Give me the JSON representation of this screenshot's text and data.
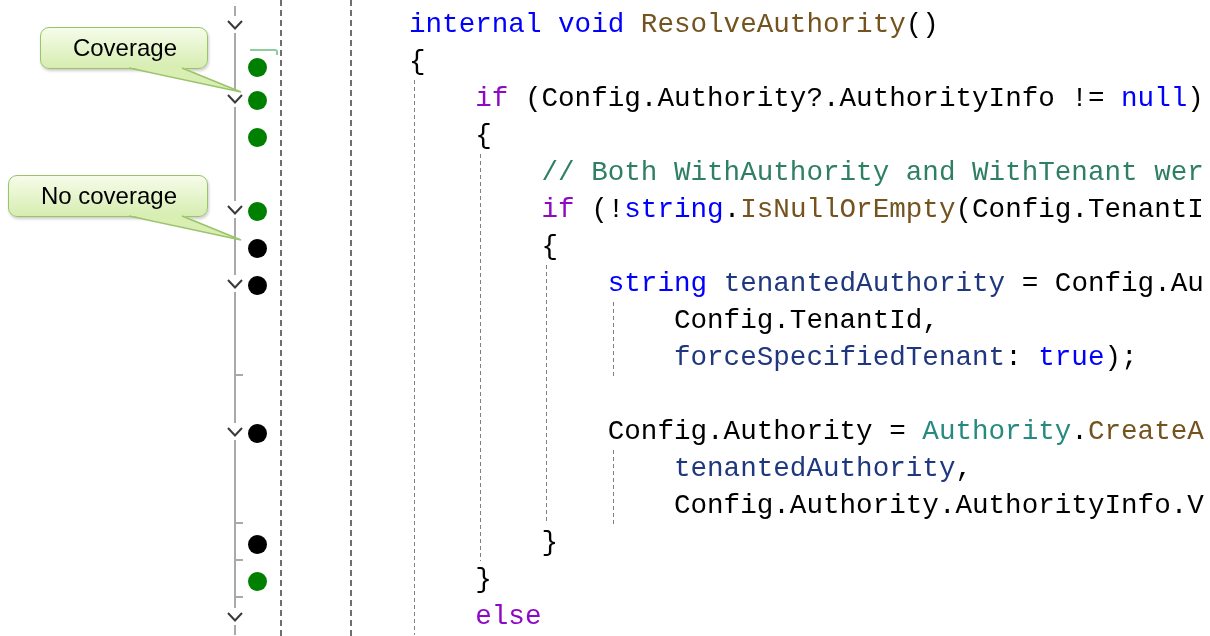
{
  "editor": {
    "lines": [
      {
        "kind": "start",
        "bracket": false,
        "tokens": [
          {
            "kind": "keyword",
            "text": "internal void "
          },
          {
            "kind": "method",
            "text": "ResolveAuthority"
          },
          {
            "kind": "plain",
            "text": "()"
          }
        ]
      },
      {
        "kind": "body",
        "bracket": true,
        "coverage": {
          "color": "#008000"
        },
        "tokens": [
          {
            "kind": "plain",
            "text": "{"
          }
        ],
        "children": [
          {
            "kind": "start",
            "bracket": false,
            "coverage": {
              "color": "#008000"
            },
            "callout": {
              "text": "Coverage"
            },
            "tokens": [
              {
                "kind": "control",
                "text": "if"
              },
              {
                "kind": "plain",
                "text": " (Config.Authority?.AuthorityInfo != "
              },
              {
                "kind": "keyword",
                "text": "null"
              },
              {
                "kind": "plain",
                "text": ")"
              }
            ]
          },
          {
            "kind": "body",
            "bracket": false,
            "coverage": {
              "color": "#008000"
            },
            "tokens": [
              {
                "kind": "plain",
                "text": "{"
              }
            ],
            "children": [
              {
                "kind": "body",
                "bracket": false,
                "tokens": [
                  {
                    "kind": "comment",
                    "text": "// Both WithAuthority and WithTenant wer"
                  }
                ]
              },
              {
                "kind": "start",
                "bracket": false,
                "coverage": {
                  "color": "#008000"
                },
                "tokens": [
                  {
                    "kind": "control",
                    "text": "if"
                  },
                  {
                    "kind": "plain",
                    "text": " (!"
                  },
                  {
                    "kind": "keyword",
                    "text": "string"
                  },
                  {
                    "kind": "plain",
                    "text": "."
                  },
                  {
                    "kind": "method",
                    "text": "IsNullOrEmpty"
                  },
                  {
                    "kind": "plain",
                    "text": "(Config.TenantI"
                  }
                ]
              },
              {
                "kind": "body",
                "bracket": false,
                "coverage": {
                  "color": "#000000"
                },
                "callout": {
                  "text": "No coverage"
                },
                "tokens": [
                  {
                    "kind": "plain",
                    "text": "{"
                  }
                ],
                "children": [
                  {
                    "kind": "start",
                    "bracket": false,
                    "coverage": {
                      "color": "#000000"
                    },
                    "tokens": [
                      {
                        "kind": "keyword",
                        "text": "string "
                      },
                      {
                        "kind": "variable",
                        "text": "tenantedAuthority"
                      },
                      {
                        "kind": "plain",
                        "text": " = Config.Au"
                      }
                    ],
                    "children": [
                      {
                        "kind": "body",
                        "bracket": false,
                        "tokens": [
                          {
                            "kind": "plain",
                            "text": "Config.TenantId,"
                          }
                        ]
                      },
                      {
                        "kind": "end",
                        "bracket": false,
                        "tokens": [
                          {
                            "kind": "variable",
                            "text": "forceSpecifiedTenant"
                          },
                          {
                            "kind": "plain",
                            "text": ": "
                          },
                          {
                            "kind": "keyword",
                            "text": "true"
                          },
                          {
                            "kind": "plain",
                            "text": ");"
                          }
                        ]
                      }
                    ]
                  },
                  {
                    "kind": "body",
                    "bracket": false
                  },
                  {
                    "kind": "start",
                    "bracket": false,
                    "coverage": {
                      "color": "#000000"
                    },
                    "tokens": [
                      {
                        "kind": "plain",
                        "text": "Config.Authority = "
                      },
                      {
                        "kind": "type",
                        "text": "Authority"
                      },
                      {
                        "kind": "plain",
                        "text": "."
                      },
                      {
                        "kind": "method",
                        "text": "CreateA"
                      }
                    ],
                    "children": [
                      {
                        "kind": "body",
                        "bracket": false,
                        "tokens": [
                          {
                            "kind": "variable",
                            "text": "tenantedAuthority"
                          },
                          {
                            "kind": "plain",
                            "text": ","
                          }
                        ]
                      },
                      {
                        "kind": "end",
                        "bracket": false,
                        "tokens": [
                          {
                            "kind": "plain",
                            "text": "Config.Authority.AuthorityInfo.V"
                          }
                        ]
                      }
                    ]
                  }
                ]
              },
              {
                "kind": "end",
                "bracket": false,
                "coverage": {
                  "color": "#000000"
                },
                "tokens": [
                  {
                    "kind": "plain",
                    "text": "}"
                  }
                ]
              }
            ]
          },
          {
            "kind": "end",
            "bracket": false,
            "coverage": {
              "color": "#008000"
            },
            "tokens": [
              {
                "kind": "plain",
                "text": "}"
              }
            ]
          },
          {
            "kind": "start",
            "bracket": false,
            "tokens": [
              {
                "kind": "control",
                "text": "else"
              }
            ]
          }
        ]
      }
    ]
  }
}
